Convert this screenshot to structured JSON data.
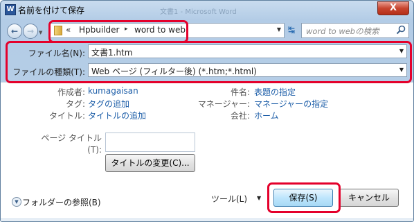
{
  "window": {
    "title": "名前を付けて保存",
    "app_icon_letter": "W",
    "ghost_title": "文書1 - Microsoft Word",
    "close_glyph": "X"
  },
  "nav": {
    "back_glyph": "←",
    "forward_glyph": "→",
    "path_prefix": "«",
    "path": [
      "Hpbuilder",
      "word to web"
    ],
    "path_separator": "▸",
    "refresh_glyph": "↹",
    "search_placeholder": "word to webの検索"
  },
  "file": {
    "name_label": "ファイル名(N):",
    "name_value": "文書1.htm",
    "type_label": "ファイルの種類(T):",
    "type_value": "Web ページ (フィルター後) (*.htm;*.html)"
  },
  "meta": {
    "author_label": "作成者:",
    "author_value": "kumagaisan",
    "tags_label": "タグ:",
    "tags_value": "タグの追加",
    "title_label": "タイトル:",
    "title_value": "タイトルの追加",
    "subject_label": "件名:",
    "subject_value": "表題の指定",
    "manager_label": "マネージャー:",
    "manager_value": "マネージャーの指定",
    "company_label": "会社:",
    "company_value": "ホーム"
  },
  "page_title": {
    "label_line1": "ページ タイトル",
    "label_line2": "(T):",
    "change_button": "タイトルの変更(C)..."
  },
  "footer": {
    "browse_label": "フォルダーの参照(B)",
    "tools_label": "ツール(L)",
    "save_button": "保存(S)",
    "cancel_button": "キャンセル"
  },
  "colors": {
    "highlight_box": "#e4002b",
    "link_blue": "#1d5ea8"
  }
}
